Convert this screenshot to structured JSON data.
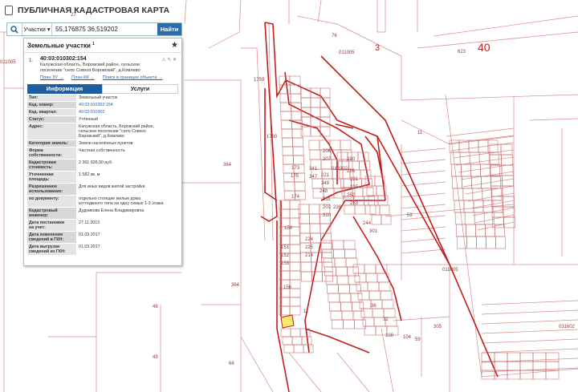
{
  "app": {
    "title": "ПУБЛИЧНАЯ КАДАСТРОВАЯ КАРТА"
  },
  "search": {
    "mode": "Участки",
    "value": "55,176875 36,519202",
    "button": "Найти"
  },
  "panel": {
    "title": "Земельные участки",
    "count": "1",
    "item_index": "1.",
    "parcel_number": "40:03:010302:154",
    "address_lines": [
      "Калужская область, Боровский район, сельское",
      "поселение \"село Совхоз Боровский\", д.Комлево"
    ],
    "links": [
      "План ЗУ →",
      "План КК →",
      "Поиск в границах объекта →"
    ],
    "tabs": {
      "info": "Информация",
      "services": "Услуги"
    },
    "rows": [
      {
        "k": [
          "Тип:"
        ],
        "v": [
          "Земельный участок"
        ]
      },
      {
        "k": [
          "Кад. номер:"
        ],
        "v": [
          "40:03:010302:154"
        ],
        "link": true
      },
      {
        "k": [
          "Кад. квартал:"
        ],
        "v": [
          "40:03:010302"
        ],
        "link": true
      },
      {
        "k": [
          "Статус:"
        ],
        "v": [
          "Учтенный"
        ]
      },
      {
        "k": [
          "Адрес:"
        ],
        "v": [
          "Калужская область, Боровский район,",
          "сельское поселение \"село Совхоз",
          "Боровский\", д.Комлево"
        ]
      },
      {
        "k": [
          "Категория земель:"
        ],
        "v": [
          "Земли населённых пунктов"
        ]
      },
      {
        "k": [
          "Форма",
          "собственности:"
        ],
        "v": [
          "Частная собственность"
        ]
      },
      {
        "k": [
          "Кадастровая",
          "стоимость:"
        ],
        "v": [
          "2 361 926,00 руб."
        ]
      },
      {
        "k": [
          "Уточненная",
          "площадь:"
        ],
        "v": [
          "1 582 кв. м"
        ]
      },
      {
        "k": [
          "Разрешенное",
          "использование:"
        ],
        "v": [
          "Для иных видов жилой застройки"
        ]
      },
      {
        "k": [
          "по документу:"
        ],
        "v": [
          "отдельно стоящие жилые дома",
          "коттеджного типа на одну семью 1-3 этажа"
        ]
      },
      {
        "k": [
          "Кадастровый",
          "инженер:"
        ],
        "v": [
          "Дудникова Елена Владимировна"
        ]
      },
      {
        "k": [
          "Дата постановки",
          "на учет:"
        ],
        "v": [
          "27.11.2013"
        ]
      },
      {
        "k": [
          "Дата изменения",
          "сведений в ГКН:"
        ],
        "v": [
          "01.03.2017"
        ]
      },
      {
        "k": [
          "Дата выгрузки",
          "сведений из ГКН:"
        ],
        "v": [
          "01.03.2017"
        ]
      }
    ]
  },
  "map": {
    "big_labels": [
      "3",
      "40"
    ],
    "quarter_labels": [
      "011005",
      "011005",
      "011005",
      "031602",
      "010302"
    ],
    "parcel_labels": [
      "27",
      "76",
      "623",
      "1759",
      "1760",
      "364",
      "364",
      "48",
      "49",
      "66",
      "11",
      "11",
      "59",
      "59",
      "36",
      "32",
      "108",
      "104",
      "305",
      "156",
      "173",
      "175",
      "159",
      "174",
      "151",
      "152",
      "153",
      "208",
      "207",
      "221",
      "341",
      "347",
      "349",
      "248",
      "211",
      "230",
      "252",
      "253",
      "203",
      "310",
      "226",
      "231",
      "235",
      "238",
      "244",
      "301",
      "224",
      "225",
      "214"
    ],
    "colors": {
      "boundary": "#c21d1d",
      "thin": "#d98a8a",
      "highlight": "#f6ec6a"
    }
  }
}
